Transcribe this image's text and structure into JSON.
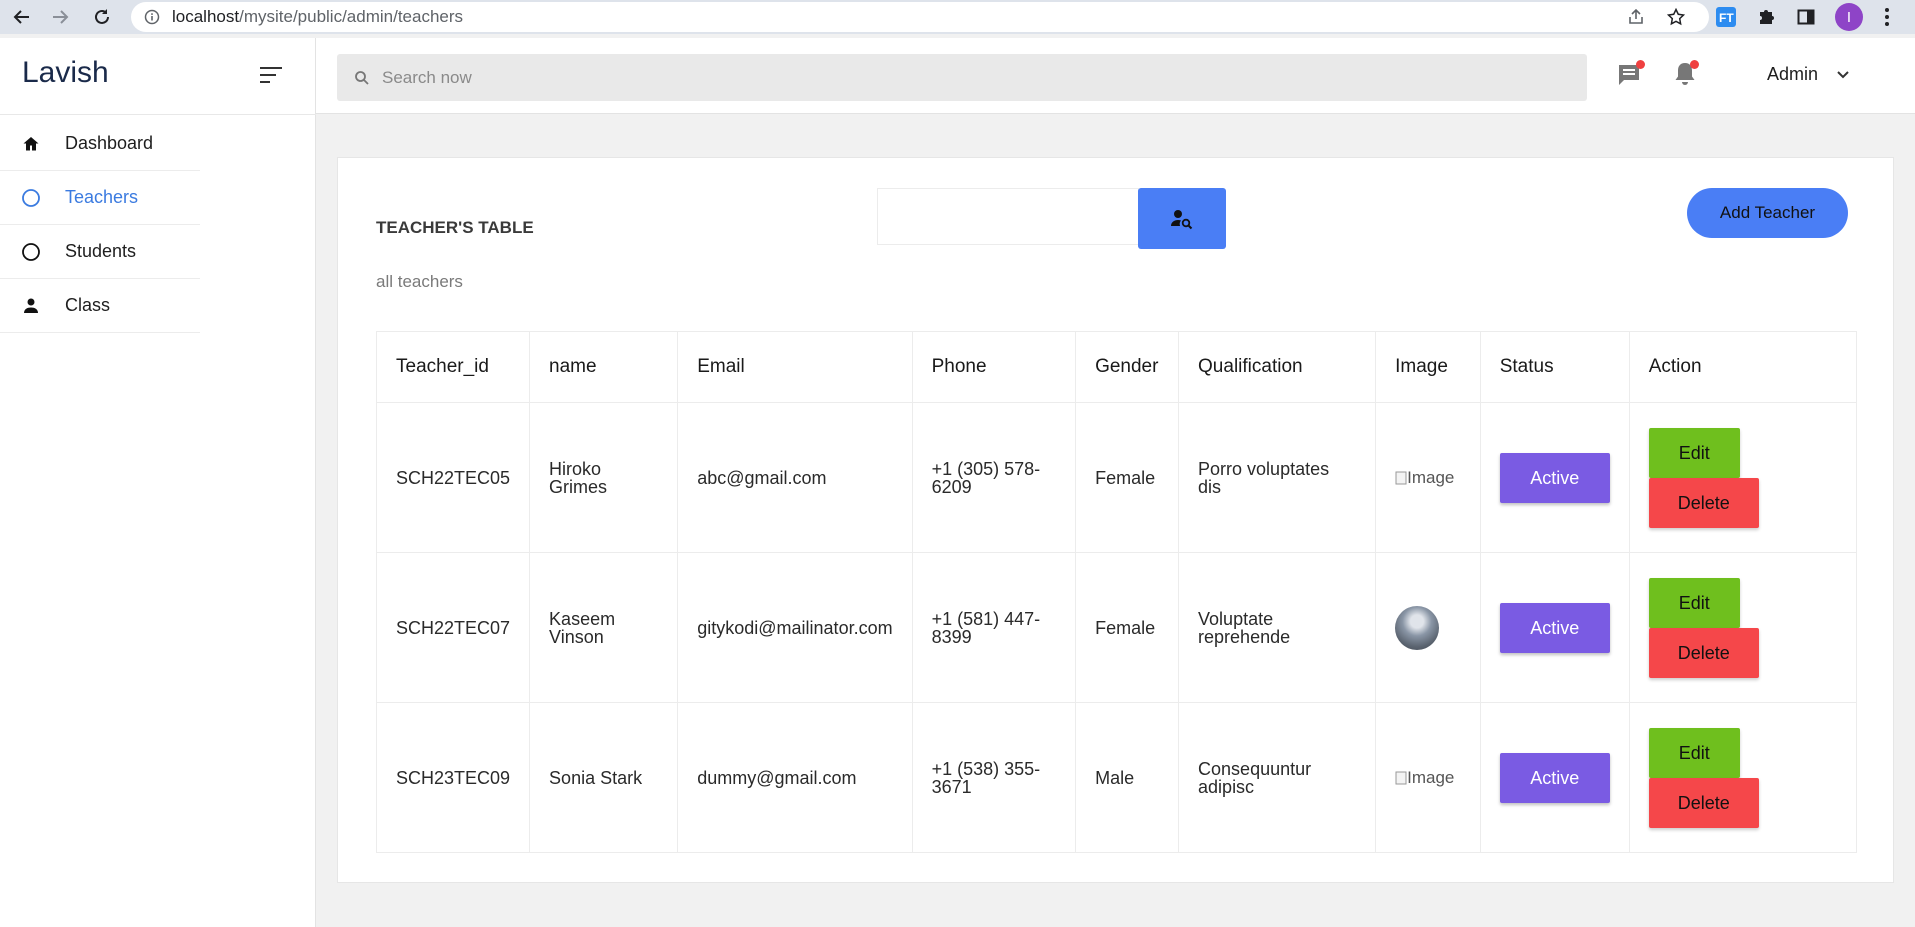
{
  "browser": {
    "url_host": "localhost",
    "url_path": "/mysite/public/admin/teachers",
    "profile_initial": "I",
    "icons": [
      "back-arrow-icon",
      "forward-arrow-icon",
      "reload-icon",
      "info-icon",
      "share-icon",
      "star-icon",
      "extension-ft-icon",
      "puzzle-icon",
      "sidepanel-icon",
      "kebab-menu-icon"
    ]
  },
  "sidebar": {
    "brand": "Lavish",
    "items": [
      {
        "label": "Dashboard",
        "icon": "home-icon",
        "active": false
      },
      {
        "label": "Teachers",
        "icon": "circle-icon",
        "active": true
      },
      {
        "label": "Students",
        "icon": "circle-icon",
        "active": false
      },
      {
        "label": "Class",
        "icon": "person-icon",
        "active": false
      }
    ]
  },
  "topbar": {
    "search_placeholder": "Search now",
    "admin_label": "Admin"
  },
  "card": {
    "title": "TEACHER'S TABLE",
    "subtitle": "all teachers",
    "search_value": "",
    "add_label": "Add Teacher"
  },
  "table": {
    "columns": [
      "Teacher_id",
      "name",
      "Email",
      "Phone",
      "Gender",
      "Qualification",
      "Image",
      "Status",
      "Action"
    ],
    "rows": [
      {
        "id": "SCH22TEC05",
        "name": "Hiroko Grimes",
        "email": "abc@gmail.com",
        "phone": "+1 (305) 578-6209",
        "gender": "Female",
        "qualification": "Porro voluptates dis",
        "image_alt": "Image",
        "image_loaded": false,
        "status": "Active",
        "edit": "Edit",
        "delete": "Delete"
      },
      {
        "id": "SCH22TEC07",
        "name": "Kaseem Vinson",
        "email": "gitykodi@mailinator.com",
        "phone": "+1 (581) 447-8399",
        "gender": "Female",
        "qualification": "Voluptate reprehende",
        "image_alt": "",
        "image_loaded": true,
        "status": "Active",
        "edit": "Edit",
        "delete": "Delete"
      },
      {
        "id": "SCH23TEC09",
        "name": "Sonia Stark",
        "email": "dummy@gmail.com",
        "phone": "+1 (538) 355-3671",
        "gender": "Male",
        "qualification": "Consequuntur adipisc",
        "image_alt": "Image",
        "image_loaded": false,
        "status": "Active",
        "edit": "Edit",
        "delete": "Delete"
      }
    ]
  },
  "colors": {
    "primary": "#4a7ef5",
    "status": "#7a5be3",
    "edit": "#6fbf1e",
    "delete": "#f5474a",
    "active_menu": "#3b7be0"
  }
}
